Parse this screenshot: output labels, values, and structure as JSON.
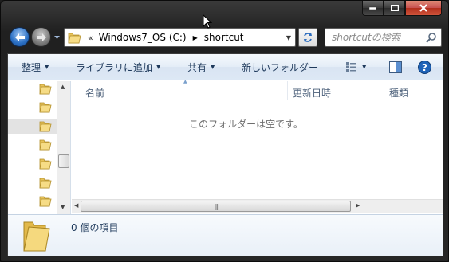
{
  "address_bar": {
    "overflow_chevron": "«",
    "crumbs": [
      "Windows7_OS (C:)",
      "shortcut"
    ]
  },
  "search": {
    "placeholder": "shortcutの検索"
  },
  "toolbar": {
    "organize": "整理",
    "add_to_library": "ライブラリに追加",
    "share": "共有",
    "new_folder": "新しいフォルダー"
  },
  "columns": {
    "name": "名前",
    "date_modified": "更新日時",
    "type": "種類"
  },
  "content": {
    "empty_message": "このフォルダーは空です。"
  },
  "details": {
    "item_count": "0 個の項目"
  },
  "icons": {
    "back": "back-arrow-icon",
    "forward": "forward-arrow-icon",
    "refresh": "refresh-icon",
    "search": "magnifier-icon",
    "folder": "folder-icon",
    "views": "views-icon",
    "preview_pane": "preview-pane-icon",
    "help": "help-icon"
  },
  "colors": {
    "toolbar_text": "#1e395b",
    "back_button": "#2a6fc4",
    "help_button": "#1f63b8"
  }
}
